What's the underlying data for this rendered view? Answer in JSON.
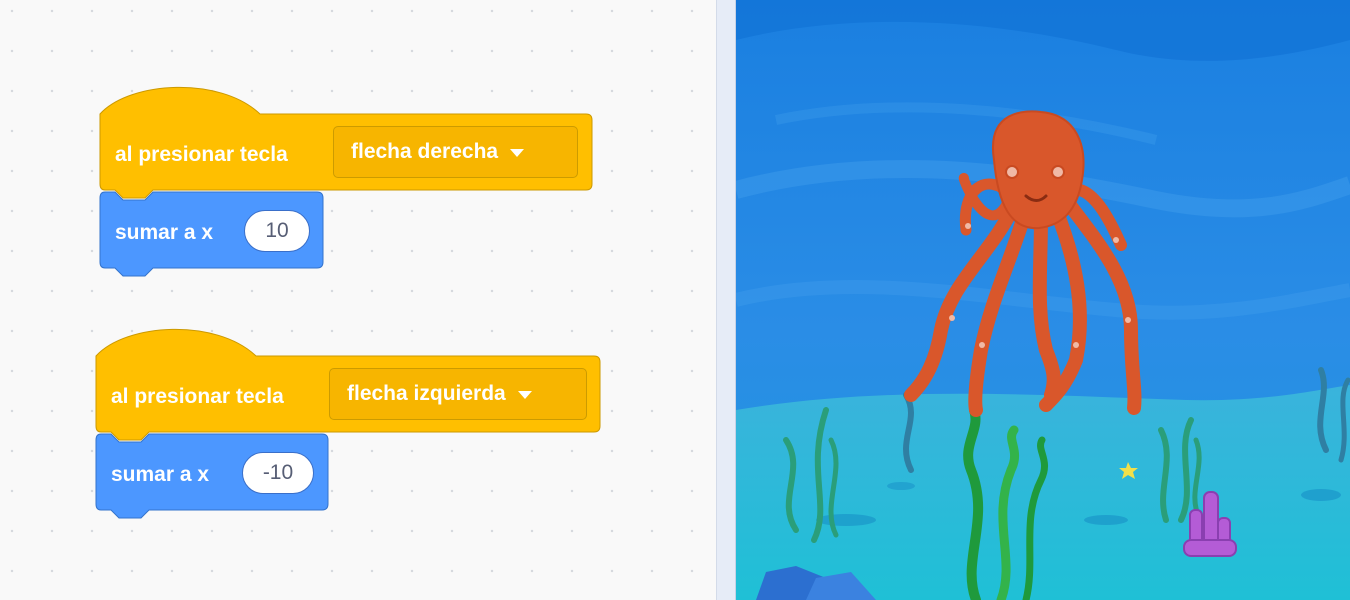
{
  "scripts": [
    {
      "hat_label": "al presionar tecla",
      "key_option": "flecha derecha",
      "motion_label": "sumar a x",
      "motion_value": "10"
    },
    {
      "hat_label": "al presionar tecla",
      "key_option": "flecha izquierda",
      "motion_label": "sumar a x",
      "motion_value": "-10"
    }
  ],
  "colors": {
    "events_block": "#ffbf00",
    "motion_block": "#4c97ff",
    "stage_water": "#2a8de6",
    "octopus": "#d9572b"
  },
  "stage": {
    "backdrop": "underwater",
    "sprite": "octopus-icon"
  }
}
